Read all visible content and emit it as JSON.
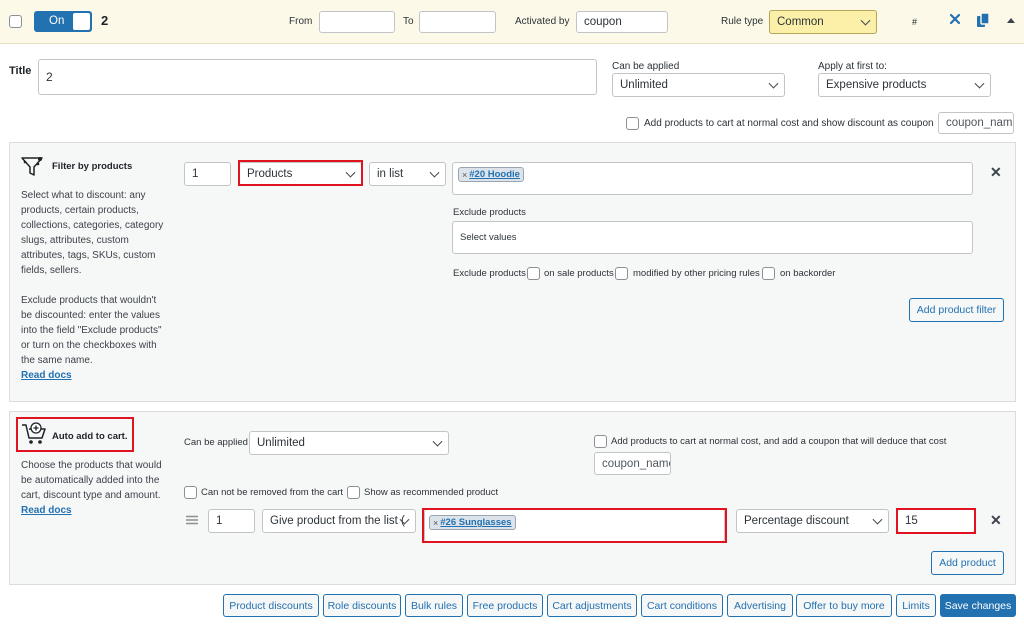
{
  "header": {
    "toggle_label": "On",
    "rule_number": "2",
    "from_label": "From",
    "from_value": "",
    "to_label": "To",
    "to_value": "",
    "activated_by_label": "Activated by",
    "activated_by_value": "coupon",
    "rule_type_label": "Rule type",
    "rule_type_value": "Common",
    "hash_label": "#",
    "accent_color": "#2271b1",
    "bar_color": "#fcf9e8"
  },
  "settings": {
    "title_label": "Title",
    "title_value": "2",
    "can_be_applied_label": "Can be applied",
    "can_be_applied_value": "Unlimited",
    "apply_first_label": "Apply at first to:",
    "apply_first_value": "Expensive products",
    "coupon_checkbox_label": "Add products to cart at normal cost and show discount as coupon",
    "coupon_name_placeholder": "coupon_name"
  },
  "filter": {
    "heading": "Filter by products",
    "description": "Select what to discount: any products, certain products, collections, categories, category slugs, attributes, custom attributes, tags, SKUs, custom fields, sellers.",
    "exclude_description": "Exclude products that wouldn't be discounted: enter the values into the field \"Exclude products\" or turn on the checkboxes with the same name.",
    "read_docs": "Read docs",
    "qty_value": "1",
    "type_value": "Products",
    "condition_value": "in list",
    "tag_label": "#20 Hoodie",
    "exclude_label": "Exclude products",
    "exclude_placeholder": "Select values",
    "exclude_checks_label": "Exclude products",
    "check_on_sale": "on sale products",
    "check_modified": "modified by other pricing rules",
    "check_backorder": "on backorder",
    "add_filter_button": "Add product filter"
  },
  "autoadd": {
    "heading": "Auto add to cart.",
    "description": "Choose the products that would be automatically added into the cart, discount type and amount.",
    "read_docs": "Read docs",
    "can_be_applied_label": "Can be applied",
    "can_be_applied_value": "Unlimited",
    "normal_cost_label": "Add products to cart at normal cost, and add a coupon that will deduce that cost",
    "coupon_name_placeholder": "coupon_name",
    "not_removed_label": "Can not be removed from the cart",
    "recommended_label": "Show as recommended product",
    "qty_value": "1",
    "give_value": "Give product from the list (",
    "tag_label": "#26 Sunglasses",
    "discount_type_value": "Percentage discount",
    "discount_value": "15",
    "add_product_button": "Add product"
  },
  "footer_buttons": [
    "Product discounts",
    "Role discounts",
    "Bulk rules",
    "Free products",
    "Cart adjustments",
    "Cart conditions",
    "Advertising",
    "Offer to buy more",
    "Limits",
    "Save changes"
  ],
  "highlight_color": "#e0141e"
}
